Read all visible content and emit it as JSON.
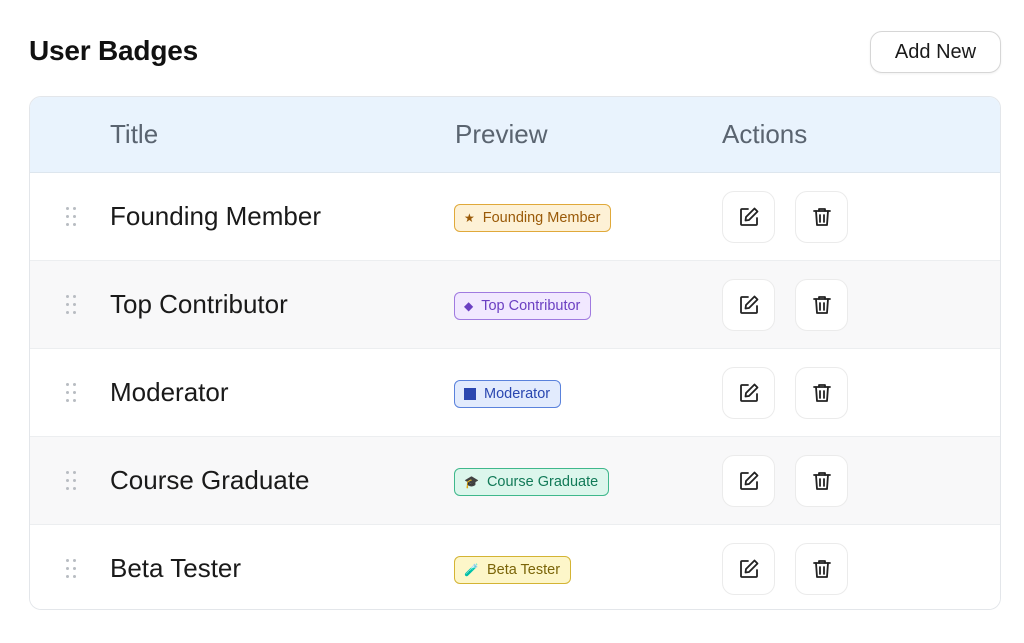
{
  "page": {
    "title": "User Badges",
    "add_button": "Add New"
  },
  "table": {
    "columns": [
      "Title",
      "Preview",
      "Actions"
    ],
    "rows": [
      {
        "title": "Founding Member",
        "badge_label": "Founding Member",
        "badge_icon": "star-icon",
        "badge_glyph": "★",
        "bg": "#fdf1d6",
        "border": "#e0a93a",
        "color": "#9a5a08"
      },
      {
        "title": "Top Contributor",
        "badge_label": "Top Contributor",
        "badge_icon": "diamond-icon",
        "badge_glyph": "◆",
        "bg": "#f1e8ff",
        "border": "#a07ae0",
        "color": "#6b3fc2"
      },
      {
        "title": "Moderator",
        "badge_label": "Moderator",
        "badge_icon": "square-icon",
        "badge_glyph": "",
        "bg": "#e2ebfd",
        "border": "#5a82dc",
        "color": "#2a47b0"
      },
      {
        "title": "Course Graduate",
        "badge_label": "Course Graduate",
        "badge_icon": "graduation-cap-icon",
        "badge_glyph": "🎓",
        "bg": "#dcf6ec",
        "border": "#3fb88c",
        "color": "#127a58"
      },
      {
        "title": "Beta Tester",
        "badge_label": "Beta Tester",
        "badge_icon": "test-tube-icon",
        "badge_glyph": "🧪",
        "bg": "#fdf6c9",
        "border": "#d4b434",
        "color": "#7a6408"
      }
    ]
  },
  "colors": {
    "header_bg": "#e9f3fd",
    "alt_row_bg": "#f8f8f9"
  }
}
